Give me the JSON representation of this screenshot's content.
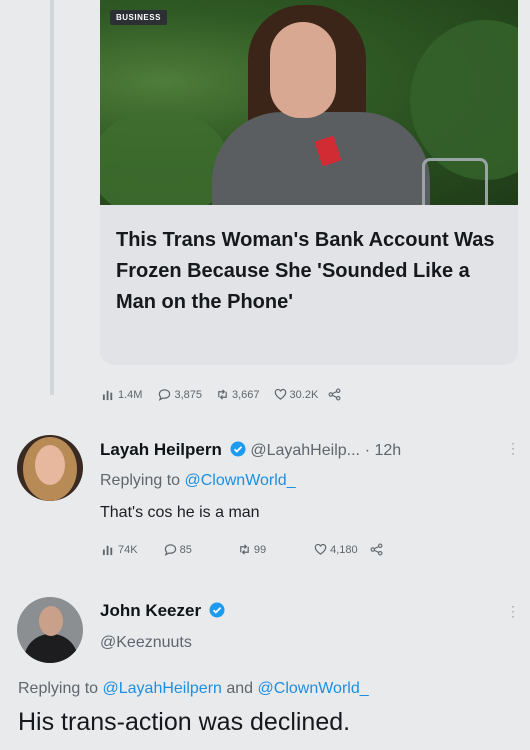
{
  "article": {
    "badge": "BUSINESS",
    "headline": "This Trans Woman's Bank Account Was Frozen Because She 'Sounded Like a Man on the Phone'"
  },
  "tweet1_stats": {
    "views": "1.4M",
    "replies": "3,875",
    "retweets": "3,667",
    "likes": "30.2K"
  },
  "reply1": {
    "name": "Layah Heilpern",
    "handle": "@LayahHeilp...",
    "time": "· 12h",
    "replying_prefix": "Replying to",
    "replying_to": "@ClownWorld_",
    "text": "That's cos he is a man",
    "stats": {
      "views": "74K",
      "replies": "85",
      "retweets": "99",
      "likes": "4,180"
    }
  },
  "reply2": {
    "name": "John Keezer",
    "handle": "@Keeznuuts",
    "replying_prefix": "Replying to",
    "replying_to_1": "@LayahHeilpern",
    "replying_and": "and",
    "replying_to_2": "@ClownWorld_",
    "text": "His trans-action was declined."
  },
  "colors": {
    "link": "#1d8fe0",
    "verified": "#1d9bf0",
    "muted": "#5e666e"
  },
  "icons": [
    "views-icon",
    "reply-icon",
    "retweet-icon",
    "like-icon",
    "share-icon",
    "verified-icon",
    "more-icon"
  ]
}
